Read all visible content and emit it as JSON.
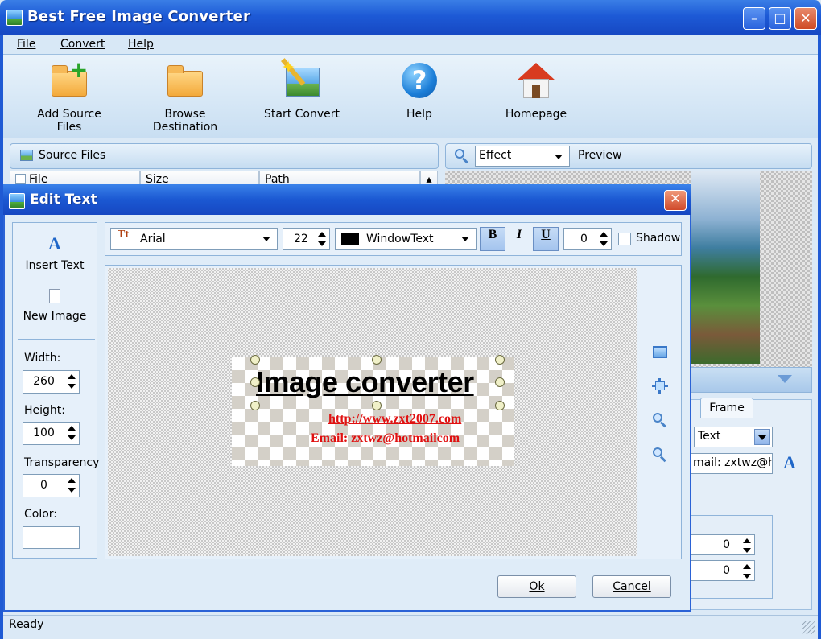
{
  "app": {
    "title": "Best Free Image Converter"
  },
  "menu": {
    "file": "File",
    "convert": "Convert",
    "help": "Help"
  },
  "toolbar": {
    "add_source": "Add Source Files",
    "browse_destination": "Browse Destination",
    "start_convert": "Start Convert",
    "help": "Help",
    "homepage": "Homepage"
  },
  "source_panel": {
    "title": "Source Files",
    "columns": [
      "File",
      "Size",
      "Path"
    ]
  },
  "preview_panel": {
    "effect_select": "Effect",
    "title": "Preview"
  },
  "right_panel": {
    "tab_frame": "Frame",
    "type_select": "Text",
    "text_value": "mail: zxtwz@ho",
    "spin1": "0",
    "spin2": "0"
  },
  "dialog": {
    "title": "Edit Text",
    "insert_text": "Insert Text",
    "new_image": "New Image",
    "width_label": "Width:",
    "width_value": "260",
    "height_label": "Height:",
    "height_value": "100",
    "transparency_label": "Transparency",
    "transparency_value": "0",
    "color_label": "Color:",
    "font": "Arial",
    "font_size": "22",
    "color_name": "WindowText",
    "bold": "B",
    "italic": "I",
    "underline": "U",
    "offset": "0",
    "shadow": "Shadow",
    "canvas": {
      "main_text": "Image converter",
      "line2": "http://www.zxt2007.com",
      "line3": "Email: zxtwz@hotmailcom"
    },
    "ok": "Ok",
    "cancel": "Cancel"
  },
  "status": {
    "text": "Ready"
  },
  "colors": {
    "title_blue": "#1d5ad6",
    "link_red": "#e01010",
    "panel_bg": "#dfecf8"
  }
}
